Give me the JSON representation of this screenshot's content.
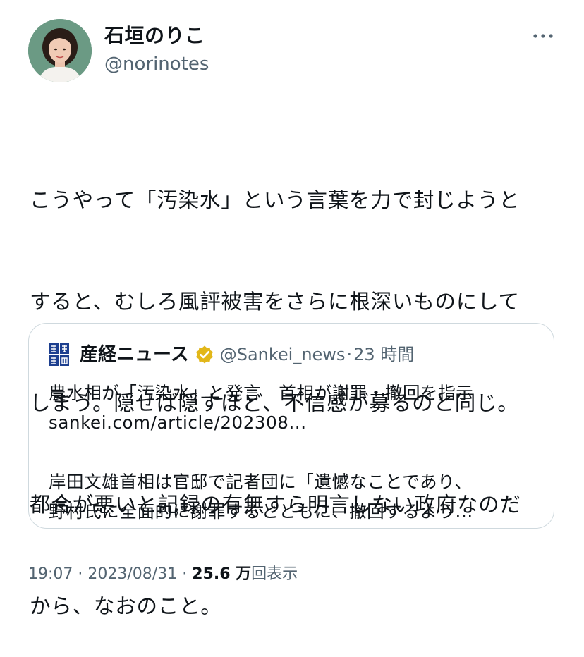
{
  "author": {
    "display_name": "石垣のりこ",
    "handle": "@norinotes"
  },
  "tweet": {
    "text_lines": [
      "こうやって「汚染水」という言葉を力で封じようと",
      "すると、むしろ風評被害をさらに根深いものにして",
      "しまう。隠せば隠すほど、不信感が募るのと同じ。",
      "都合が悪いと記録の有無すら明言しない政府なのだ",
      "から、なおのこと。"
    ]
  },
  "quote": {
    "display_name": "産経ニュース",
    "handle": "@Sankei_news",
    "separator": "·",
    "time": "23 時間",
    "lines": [
      "農水相が「汚染水」と発言　首相が謝罪・撤回を指示",
      "sankei.com/article/202308...",
      "",
      "岸田文雄首相は官邸で記者団に「遺憾なことであり、",
      "野村氏に全面的に謝罪するとともに、撤回するよう..."
    ],
    "verified_color": "#e2b719"
  },
  "footer": {
    "time": "19:07",
    "separator": "·",
    "date": "2023/08/31",
    "views_count": "25.6 万",
    "views_label": "回表示"
  },
  "icons": {
    "more": "more-horizontal-icon",
    "verified": "verified-badge-icon",
    "logo": "sankei-logo-icon"
  }
}
